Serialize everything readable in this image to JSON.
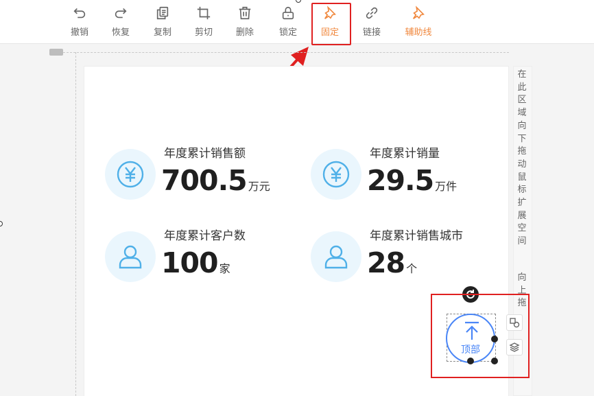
{
  "toolbar": {
    "items": [
      {
        "label": "撤销",
        "icon": "undo-icon"
      },
      {
        "label": "恢复",
        "icon": "redo-icon"
      },
      {
        "label": "复制",
        "icon": "copy-icon"
      },
      {
        "label": "剪切",
        "icon": "crop-icon"
      },
      {
        "label": "删除",
        "icon": "trash-icon"
      },
      {
        "label": "锁定",
        "icon": "lock-icon"
      },
      {
        "label": "固定",
        "icon": "pin-icon"
      },
      {
        "label": "链接",
        "icon": "link-icon"
      },
      {
        "label": "辅助线",
        "icon": "guide-pin-icon"
      }
    ]
  },
  "stats": [
    {
      "title": "年度累计销售额",
      "value": "700.5",
      "unit": "万元",
      "icon": "yen-icon"
    },
    {
      "title": "年度累计销量",
      "value": "29.5",
      "unit": "万件",
      "icon": "yen-icon"
    },
    {
      "title": "年度累计客户数",
      "value": "100",
      "unit": "家",
      "icon": "user-icon"
    },
    {
      "title": "年度累计销售城市",
      "value": "28",
      "unit": "个",
      "icon": "user-icon"
    }
  ],
  "hint": {
    "part1": "在此区域向下拖动鼠标扩展空间",
    "part2": "向上拖"
  },
  "widget": {
    "top_label": "顶部"
  },
  "colors": {
    "accent_orange": "#f0883e",
    "highlight_red": "#e02020",
    "icon_blue": "#4fb0e8",
    "button_blue": "#4a86f7"
  }
}
